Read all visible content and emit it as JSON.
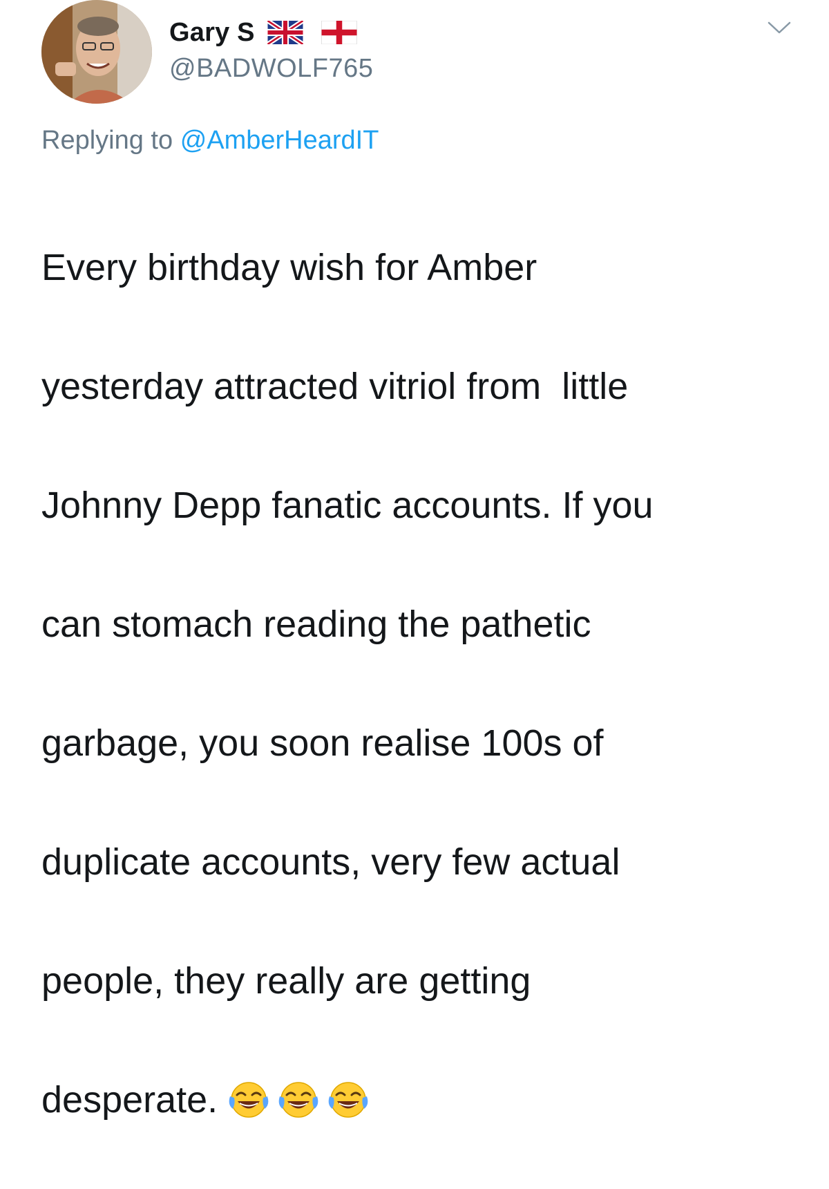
{
  "tweet": {
    "display_name": "Gary S",
    "flags": [
      "uk-flag-icon",
      "england-flag-icon"
    ],
    "handle": "@BADWOLF765",
    "reply_prefix": "Replying to",
    "reply_to": "@AmberHeardIT",
    "body_lines": [
      "Every birthday wish for Amber",
      "yesterday attracted vitriol from  little",
      "Johnny Depp fanatic accounts. If you",
      "can stomach reading the pathetic",
      "garbage, you soon realise 100s of",
      "duplicate accounts, very few actual",
      "people, they really are getting",
      "desperate."
    ],
    "emojis": [
      "tears-of-joy-emoji",
      "tears-of-joy-emoji",
      "tears-of-joy-emoji"
    ],
    "menu_icon": "chevron-down-icon"
  },
  "colors": {
    "text": "#14171a",
    "secondary": "#657786",
    "link": "#1da1f2",
    "chevron": "#8899a6"
  }
}
